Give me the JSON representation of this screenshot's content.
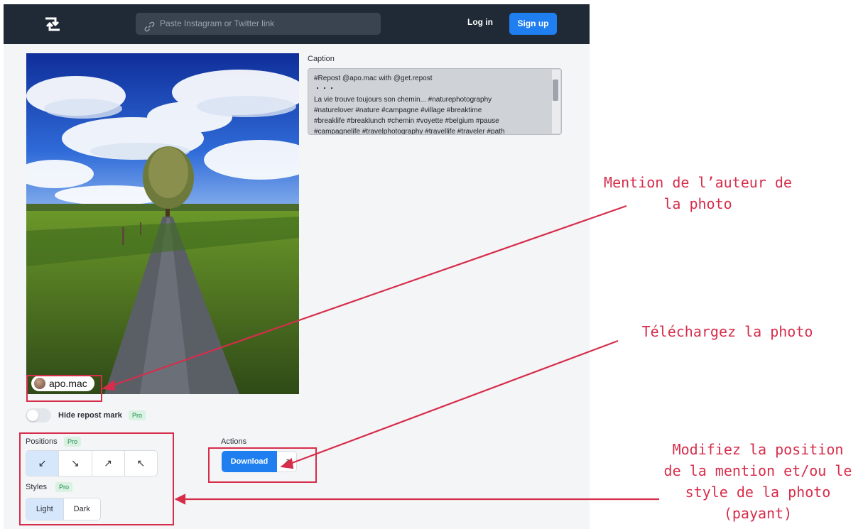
{
  "topbar": {
    "link_placeholder": "Paste Instagram or Twitter link",
    "login_label": "Log in",
    "signup_label": "Sign up"
  },
  "photo": {
    "mention_handle": "apo.mac"
  },
  "repost_mark": {
    "toggle_label": "Hide repost mark",
    "pro_badge": "Pro"
  },
  "caption": {
    "label": "Caption",
    "lines": [
      "#Repost @apo.mac with @get.repost",
      "・・・",
      "La vie trouve toujours son chemin... #naturephotography",
      "#naturelover #nature #campagne #village #breaktime",
      "#breaklife #breaklunch #chemin #voyette #belgium #pause",
      "#campagnelife #travelphotography #travellife #traveler #path"
    ]
  },
  "positions": {
    "label": "Positions",
    "pro_badge": "Pro",
    "buttons": [
      "↙",
      "↘",
      "↗",
      "↖"
    ],
    "active_index": 0
  },
  "styles": {
    "label": "Styles",
    "pro_badge": "Pro",
    "options": [
      "Light",
      "Dark"
    ],
    "active": "Light"
  },
  "actions": {
    "label": "Actions",
    "download_label": "Download",
    "extra_icon": "arrow-icon"
  },
  "annotations": {
    "author": [
      "Mention de l’auteur de",
      "la photo"
    ],
    "download": [
      "Téléchargez la photo"
    ],
    "position": [
      "Modifiez la position",
      "de la mention et/ou le",
      "style de la photo",
      "(payant)"
    ],
    "color": "#d62d4b"
  }
}
